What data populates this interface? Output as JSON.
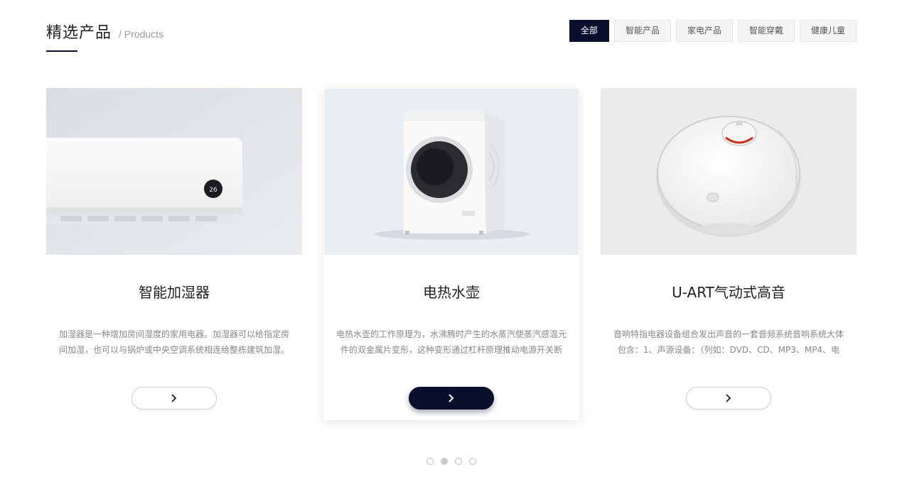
{
  "header": {
    "title_zh": "精选产品",
    "title_en": "/ Products"
  },
  "filters": [
    {
      "label": "全部",
      "active": true
    },
    {
      "label": "智能产品",
      "active": false
    },
    {
      "label": "家电产品",
      "active": false
    },
    {
      "label": "智能穿戴",
      "active": false
    },
    {
      "label": "健康儿童",
      "active": false
    }
  ],
  "cards": [
    {
      "title": "智能加湿器",
      "desc": "加湿器是一种增加房间湿度的家用电器。加湿器可以给指定房间加湿，也可以与锅炉或中央空调系统相连给整栋建筑加湿。",
      "image_icon": "air-conditioner",
      "button_icon": "chevron-right-icon"
    },
    {
      "title": "电热水壶",
      "desc": "电热水壶的工作原理为，水沸腾时产生的水蒸汽使蒸汽感温元件的双金属片变形，这种变形通过杠杆原理推动电源开关断",
      "image_icon": "washing-machine",
      "button_icon": "chevron-right-icon"
    },
    {
      "title": "U-ART气动式高音",
      "desc": "音响特指电器设备组合发出声音的一套音频系统音响系统大体包含：1、声源设备：（列如：DVD、CD、MP3、MP4、电",
      "image_icon": "robot-vacuum",
      "button_icon": "chevron-right-icon"
    }
  ],
  "pager": {
    "count": 4,
    "active_index": 1
  },
  "colors": {
    "accent": "#0a0f2e",
    "muted_text": "#888888"
  }
}
